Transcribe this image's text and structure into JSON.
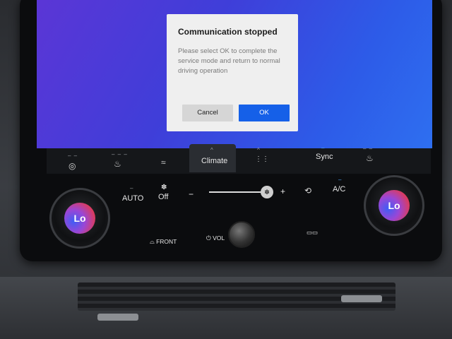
{
  "dialog": {
    "title": "Communication stopped",
    "message": "Please select OK to complete the service mode and return to normal driving operation",
    "cancel_label": "Cancel",
    "ok_label": "OK"
  },
  "nav": {
    "climate_label": "Climate",
    "sync_label": "Sync",
    "dash": "– –",
    "dash3": "– – –",
    "caret": "^"
  },
  "controls": {
    "auto_label": "AUTO",
    "off_label": "Off",
    "minus": "−",
    "plus": "+",
    "ac_label": "A/C",
    "fan_level": 0.95
  },
  "knobs": {
    "left_temp": "Lo",
    "right_temp": "Lo"
  },
  "hardware": {
    "front_label": "FRONT",
    "vol_label": "VOL"
  },
  "icons": {
    "steering_heat": "steering-wheel-heat-icon",
    "seat_heat": "seat-heat-icon",
    "airflow": "airflow-icon",
    "grid": "grid-icon",
    "fan": "fan-icon",
    "recirculate": "recirculation-icon"
  }
}
